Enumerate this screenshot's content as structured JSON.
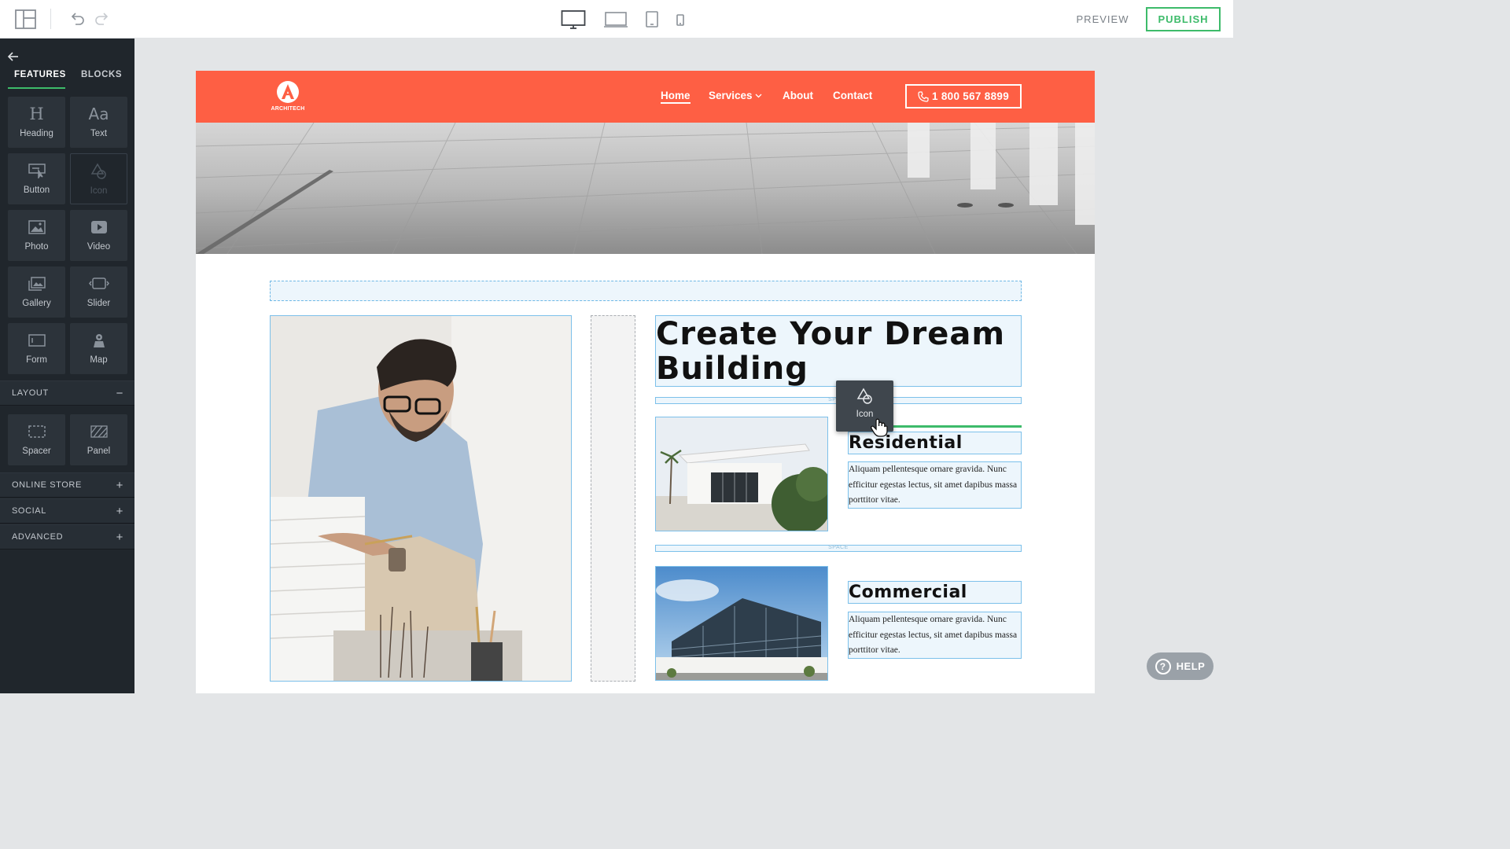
{
  "topbar": {
    "layout_icon": "layout-panels-icon",
    "undo_icon": "undo-icon",
    "redo_icon": "redo-icon",
    "devices": [
      {
        "name": "desktop",
        "icon": "desktop-icon",
        "active": true
      },
      {
        "name": "laptop",
        "icon": "laptop-icon",
        "active": false
      },
      {
        "name": "tablet",
        "icon": "tablet-icon",
        "active": false
      },
      {
        "name": "mobile",
        "icon": "mobile-icon",
        "active": false
      }
    ],
    "preview_label": "PREVIEW",
    "publish_label": "PUBLISH",
    "accent_color": "#3dbb6a"
  },
  "sidebar": {
    "back_icon": "back-arrow-icon",
    "tabs": [
      {
        "label": "FEATURES",
        "active": true
      },
      {
        "label": "BLOCKS",
        "active": false
      }
    ],
    "features": [
      {
        "label": "Heading",
        "icon": "heading-icon",
        "glyph": "H"
      },
      {
        "label": "Text",
        "icon": "text-icon",
        "glyph": "Aa"
      },
      {
        "label": "Button",
        "icon": "button-icon"
      },
      {
        "label": "Icon",
        "icon": "icon-shapes-icon",
        "disabled": true
      },
      {
        "label": "Photo",
        "icon": "photo-icon"
      },
      {
        "label": "Video",
        "icon": "video-icon"
      },
      {
        "label": "Gallery",
        "icon": "gallery-icon"
      },
      {
        "label": "Slider",
        "icon": "slider-icon"
      },
      {
        "label": "Form",
        "icon": "form-icon"
      },
      {
        "label": "Map",
        "icon": "map-icon"
      }
    ],
    "sections": {
      "layout": {
        "label": "LAYOUT",
        "sign": "−"
      },
      "online_store": {
        "label": "ONLINE STORE",
        "sign": "+"
      },
      "social": {
        "label": "SOCIAL",
        "sign": "+"
      },
      "advanced": {
        "label": "ADVANCED",
        "sign": "+"
      }
    },
    "layout_items": [
      {
        "label": "Spacer",
        "icon": "spacer-icon"
      },
      {
        "label": "Panel",
        "icon": "panel-icon"
      }
    ]
  },
  "site": {
    "brand_color": "#fe5f44",
    "logo_text": "ARCHITECH",
    "nav": {
      "home": "Home",
      "services": "Services",
      "about": "About",
      "contact": "Contact"
    },
    "phone": "1 800 567 8899",
    "headline": "Create Your Dream Building",
    "space_label": "SPACE",
    "cards": [
      {
        "title": "Residential",
        "body": "Aliquam pellentesque ornare gravida. Nunc efficitur egestas lectus, sit amet dapibus massa porttitor vitae."
      },
      {
        "title": "Commercial",
        "body": "Aliquam pellentesque ornare gravida. Nunc efficitur egestas lectus, sit amet dapibus massa porttitor vitae."
      }
    ]
  },
  "drag_ghost": {
    "label": "Icon",
    "icon": "icon-shapes-icon"
  },
  "help": {
    "label": "HELP",
    "icon": "question-icon",
    "glyph": "?"
  }
}
